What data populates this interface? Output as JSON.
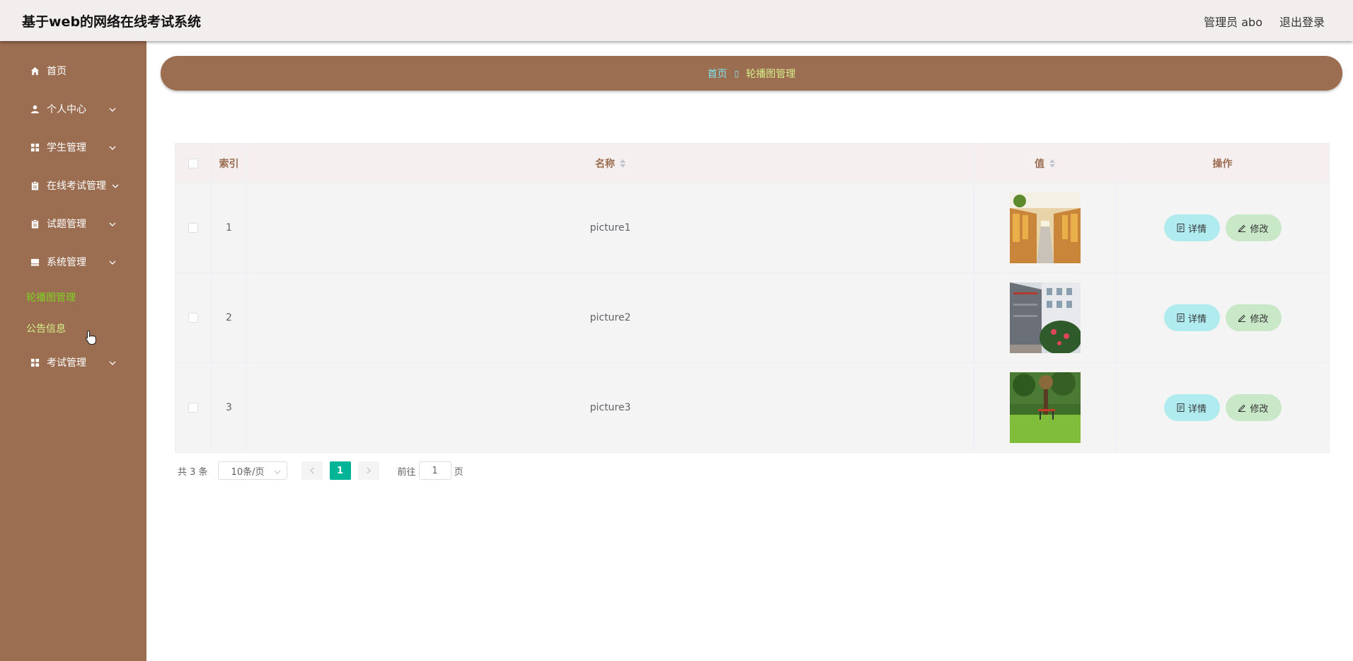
{
  "header": {
    "title": "基于web的网络在线考试系统",
    "user_label": "管理员 abo",
    "logout_label": "退出登录"
  },
  "sidebar": {
    "items": [
      {
        "label": "首页",
        "icon": "home-icon"
      },
      {
        "label": "个人中心",
        "icon": "user-icon"
      },
      {
        "label": "学生管理",
        "icon": "grid-icon"
      },
      {
        "label": "在线考试管理",
        "icon": "clipboard-icon"
      },
      {
        "label": "试题管理",
        "icon": "clipboard-icon"
      },
      {
        "label": "系统管理",
        "icon": "server-icon"
      },
      {
        "label": "考试管理",
        "icon": "grid-icon"
      }
    ],
    "sub_items": [
      {
        "label": "轮播图管理",
        "color": "#7ed321"
      },
      {
        "label": "公告信息",
        "color": "#d7f08a"
      }
    ]
  },
  "breadcrumb": {
    "home": "首页",
    "current": "轮播图管理"
  },
  "table": {
    "headers": {
      "index": "索引",
      "name": "名称",
      "value": "值",
      "ops": "操作"
    },
    "rows": [
      {
        "index": "1",
        "name": "picture1"
      },
      {
        "index": "2",
        "name": "picture2"
      },
      {
        "index": "3",
        "name": "picture3"
      }
    ],
    "detail_label": "详情",
    "edit_label": "修改"
  },
  "pagination": {
    "total": "共 3 条",
    "page_size": "10条/页",
    "current_page": "1",
    "goto_prefix": "前往",
    "goto_value": "1",
    "goto_suffix": "页"
  },
  "colors": {
    "sidebar": "#9b6d51",
    "accent": "#00b497",
    "active_sub": "#7ed321"
  }
}
